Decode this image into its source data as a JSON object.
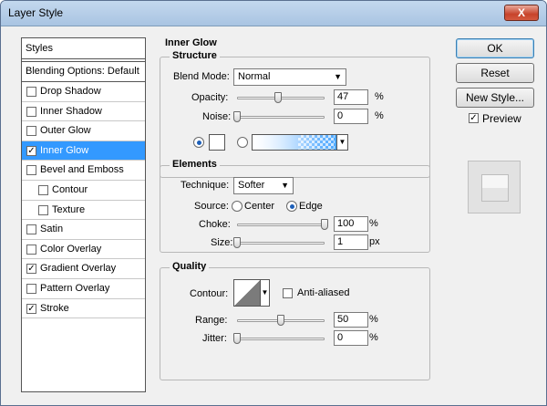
{
  "window": {
    "title": "Layer Style",
    "close_label": "X"
  },
  "styles_panel": {
    "header": "Styles",
    "blending_default": "Blending Options: Default",
    "items": [
      {
        "label": "Drop Shadow",
        "checked": false,
        "indent": false,
        "active": false
      },
      {
        "label": "Inner Shadow",
        "checked": false,
        "indent": false,
        "active": false
      },
      {
        "label": "Outer Glow",
        "checked": false,
        "indent": false,
        "active": false
      },
      {
        "label": "Inner Glow",
        "checked": true,
        "indent": false,
        "active": true
      },
      {
        "label": "Bevel and Emboss",
        "checked": false,
        "indent": false,
        "active": false
      },
      {
        "label": "Contour",
        "checked": false,
        "indent": true,
        "active": false
      },
      {
        "label": "Texture",
        "checked": false,
        "indent": true,
        "active": false
      },
      {
        "label": "Satin",
        "checked": false,
        "indent": false,
        "active": false
      },
      {
        "label": "Color Overlay",
        "checked": false,
        "indent": false,
        "active": false
      },
      {
        "label": "Gradient Overlay",
        "checked": true,
        "indent": false,
        "active": false
      },
      {
        "label": "Pattern Overlay",
        "checked": false,
        "indent": false,
        "active": false
      },
      {
        "label": "Stroke",
        "checked": true,
        "indent": false,
        "active": false
      }
    ]
  },
  "inner_glow": {
    "title": "Inner Glow",
    "structure": {
      "legend": "Structure",
      "blend_mode_label": "Blend Mode:",
      "blend_mode_value": "Normal",
      "opacity_label": "Opacity:",
      "opacity_value": "47",
      "opacity_unit": "%",
      "noise_label": "Noise:",
      "noise_value": "0",
      "noise_unit": "%",
      "color_mode": "solid"
    },
    "elements": {
      "legend": "Elements",
      "technique_label": "Technique:",
      "technique_value": "Softer",
      "source_label": "Source:",
      "source_center": "Center",
      "source_edge": "Edge",
      "source_selected": "Edge",
      "choke_label": "Choke:",
      "choke_value": "100",
      "choke_unit": "%",
      "size_label": "Size:",
      "size_value": "1",
      "size_unit": "px"
    },
    "quality": {
      "legend": "Quality",
      "contour_label": "Contour:",
      "anti_aliased_label": "Anti-aliased",
      "anti_aliased_checked": false,
      "range_label": "Range:",
      "range_value": "50",
      "range_unit": "%",
      "jitter_label": "Jitter:",
      "jitter_value": "0",
      "jitter_unit": "%"
    }
  },
  "buttons": {
    "ok": "OK",
    "reset": "Reset",
    "new_style": "New Style...",
    "preview_label": "Preview",
    "preview_checked": true
  },
  "colors": {
    "accent": "#3399ff",
    "glow": "#3da0ff"
  }
}
